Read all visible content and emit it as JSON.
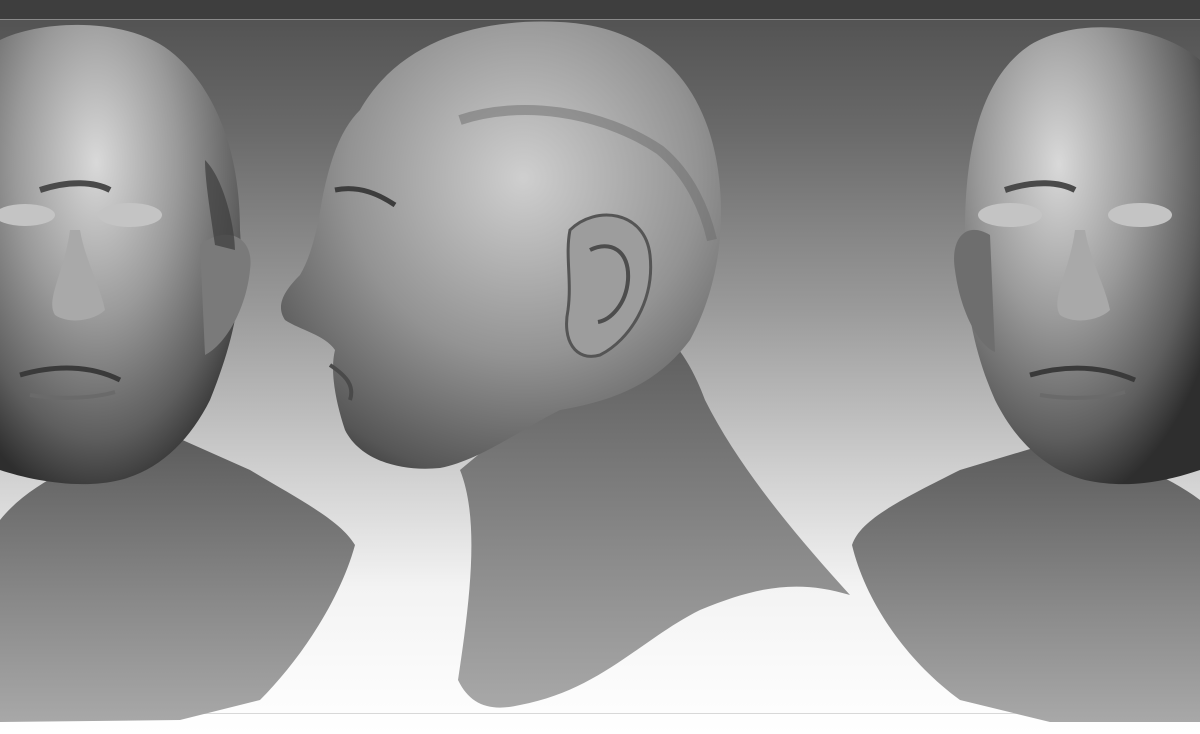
{
  "scene": {
    "background_gradient": [
      "#4f4f4f",
      "#ffffff"
    ],
    "top_bar_color": "#3e3e3e",
    "material_base": "#8c8c8c",
    "material_highlight": "#d9d9d9",
    "material_shadow": "#2e2e2e"
  },
  "views": [
    {
      "name": "front-view-left"
    },
    {
      "name": "side-profile-view"
    },
    {
      "name": "front-view-right"
    }
  ]
}
